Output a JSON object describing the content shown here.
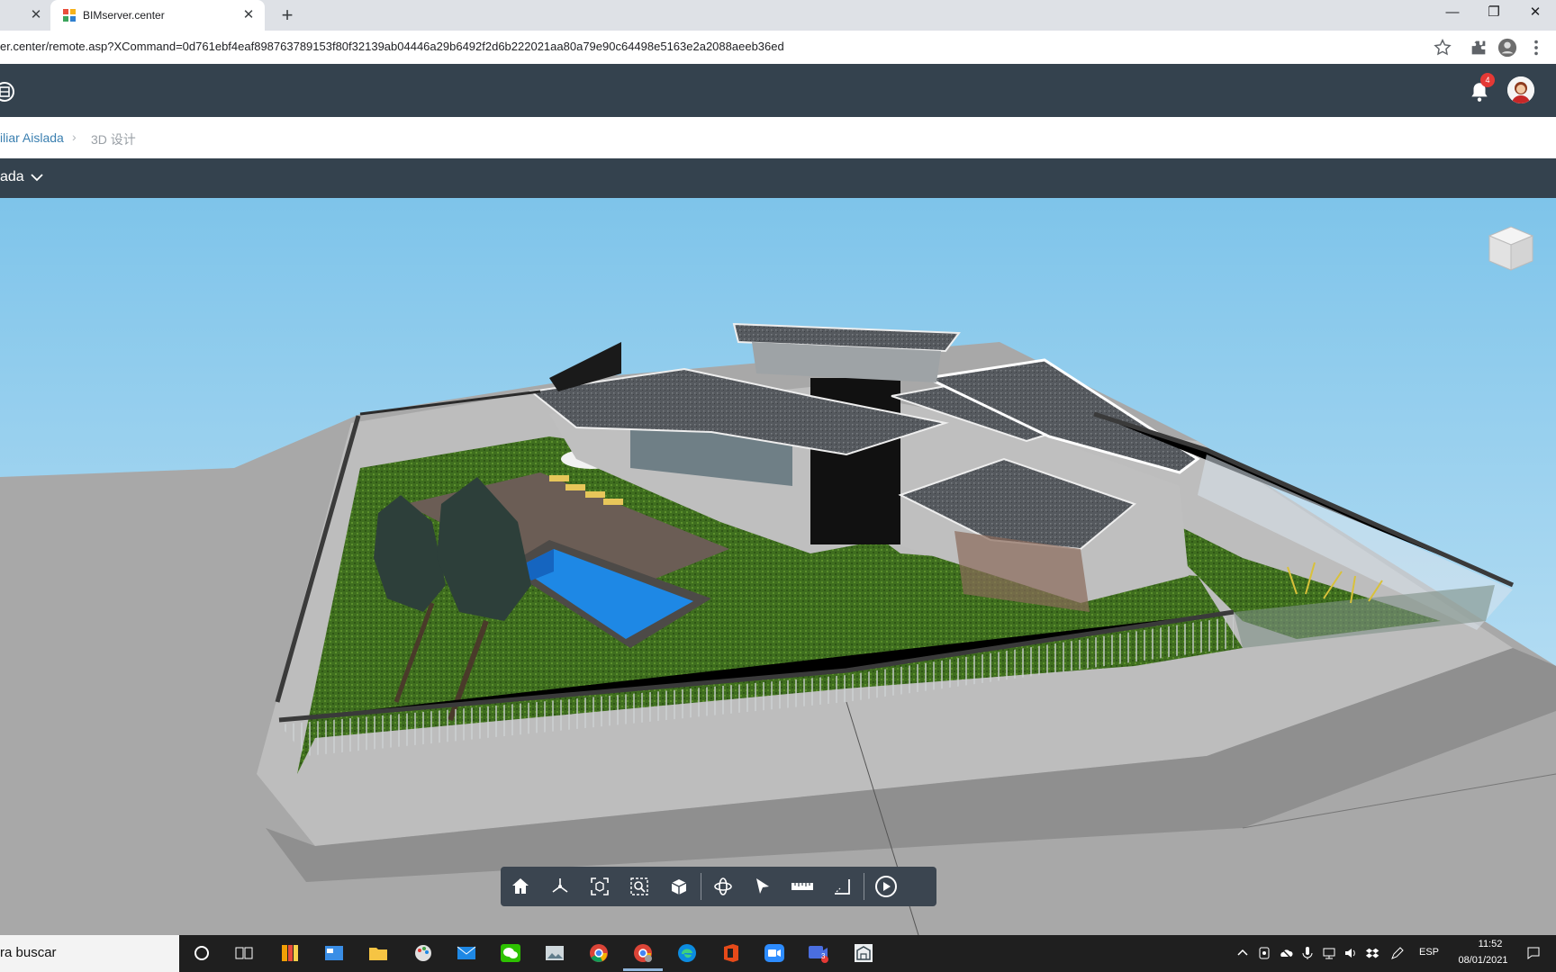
{
  "browser": {
    "tabs": [
      {
        "title": ""
      },
      {
        "title": "BIMserver.center"
      }
    ],
    "url": "er.center/remote.asp?XCommand=0d761ebf4eaf898763789153f80f32139ab04446a29b6492f2d6b222021aa80a79e90c64498e5163e2a2088aeeb36ed"
  },
  "app": {
    "notification_count": "4"
  },
  "breadcrumb": [
    "iliar Aislada",
    "3D 设计"
  ],
  "model_selector": {
    "value": "ada"
  },
  "viewer_toolbar": {
    "tools": [
      "home-icon",
      "axes-icon",
      "fit-all-icon",
      "zoom-window-icon",
      "section-box-icon",
      "orbit-icon",
      "select-pointer-icon",
      "measure-ruler-icon",
      "measure-angle-icon",
      "walk-play-icon"
    ]
  },
  "taskbar": {
    "search_placeholder": "ra buscar",
    "language": "ESP",
    "time": "11:52",
    "date": "08/01/2021",
    "meet_badge": "3"
  },
  "colors": {
    "app_header": "#34424e",
    "sky_top": "#7ec4ea",
    "sky_bottom": "#cfe9f7",
    "grass": "#3f6e1f",
    "pool": "#1e88e5",
    "roof": "#55595e",
    "ground": "#9c9c9c"
  }
}
